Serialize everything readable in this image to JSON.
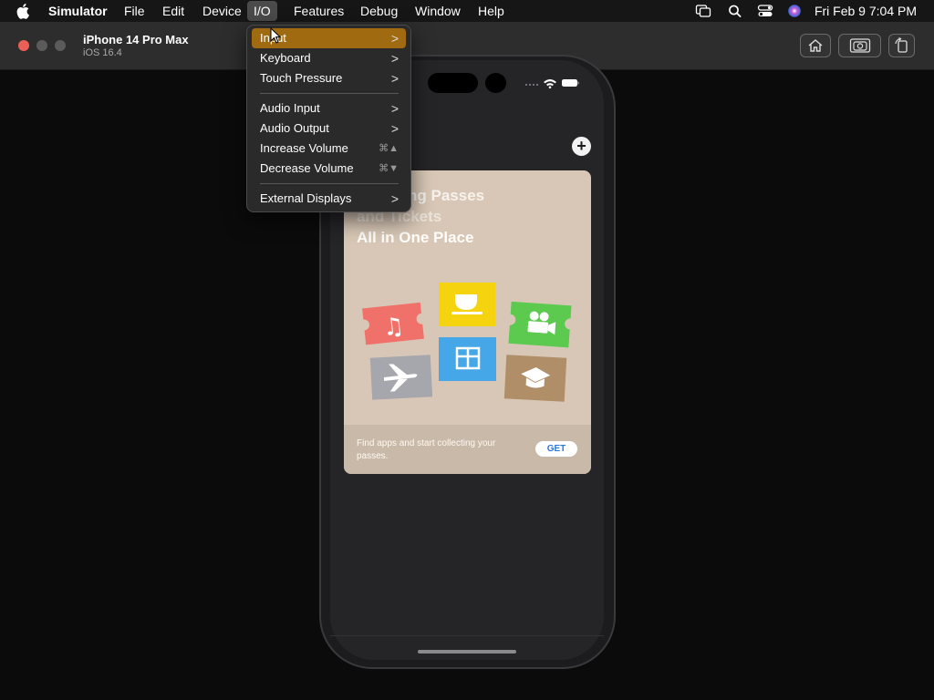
{
  "menubar": {
    "apple_icon": "apple-logo-icon",
    "items": [
      "Simulator",
      "File",
      "Edit",
      "Device",
      "I/O",
      "Features",
      "Debug",
      "Window",
      "Help"
    ],
    "active_item": "I/O",
    "clock": "Fri Feb 9  7:04 PM",
    "status_icons": [
      "screen-mirroring-icon",
      "search-icon",
      "control-center-icon",
      "siri-icon"
    ]
  },
  "window": {
    "title": "iPhone 14 Pro Max",
    "subtitle": "iOS 16.4",
    "toolbar_icons": [
      "home-icon",
      "screenshot-icon",
      "rotate-icon"
    ]
  },
  "io_menu": {
    "items": [
      {
        "label": "Input",
        "submenu": true,
        "highlighted": true
      },
      {
        "label": "Keyboard",
        "submenu": true
      },
      {
        "label": "Touch Pressure",
        "submenu": true
      },
      {
        "label": "Audio Input",
        "submenu": true
      },
      {
        "label": "Audio Output",
        "submenu": true
      },
      {
        "label": "Increase Volume",
        "shortcut": "⌘▲"
      },
      {
        "label": "Decrease Volume",
        "shortcut": "⌘▼"
      },
      {
        "label": "External Displays",
        "submenu": true
      }
    ],
    "chevron": ">"
  },
  "wallet": {
    "plus_label": "+",
    "card_title_line1": "ng Passes",
    "card_title_line2": "and Tickets",
    "card_title_line3": "All in One Place",
    "card_body": "Find apps and start collecting your passes.",
    "get_label": "GET",
    "tiles": [
      "music-ticket-icon",
      "coffee-cup-icon",
      "movie-camera-icon",
      "gift-icon",
      "airplane-icon",
      "graduation-cap-icon"
    ]
  },
  "colors": {
    "menu_highlight": "#a06a10",
    "tile_red": "#f0706a",
    "tile_yellow": "#f5d40f",
    "tile_green": "#5cc94f",
    "tile_blue": "#45a6e8",
    "tile_gray": "#a6a6ad",
    "tile_brown": "#b08e68"
  }
}
